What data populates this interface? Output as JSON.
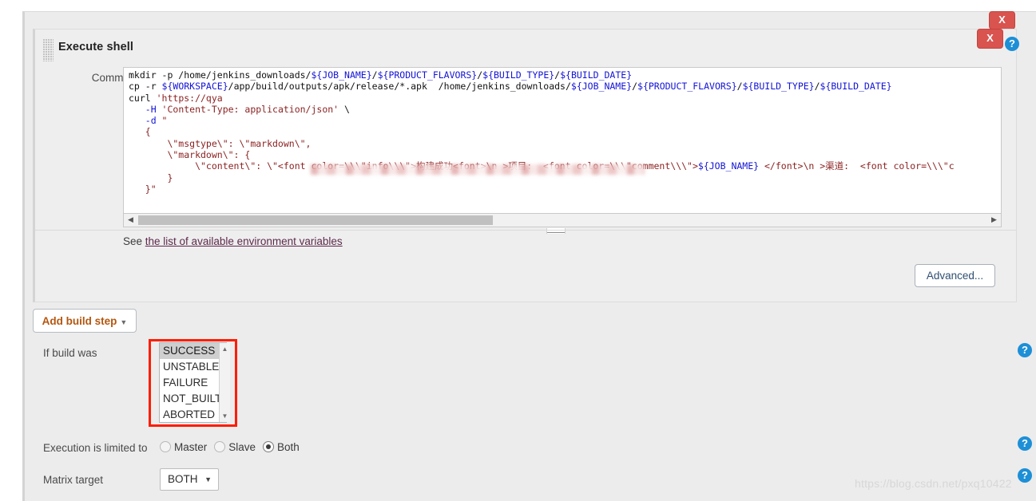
{
  "window": {
    "close_top_label": "X",
    "close_step_label": "X"
  },
  "build_step": {
    "title": "Execute shell",
    "grip_icon": "drag-grip-icon",
    "help_icon": "help-icon",
    "command": {
      "label": "Command",
      "lines": [
        [
          {
            "t": "mkdir -p /home/jenkins_downloads/",
            "c": "plain"
          },
          {
            "t": "${JOB_NAME}",
            "c": "var"
          },
          {
            "t": "/",
            "c": "plain"
          },
          {
            "t": "${PRODUCT_FLAVORS}",
            "c": "var"
          },
          {
            "t": "/",
            "c": "plain"
          },
          {
            "t": "${BUILD_TYPE}",
            "c": "var"
          },
          {
            "t": "/",
            "c": "plain"
          },
          {
            "t": "${BUILD_DATE}",
            "c": "var"
          }
        ],
        [
          {
            "t": "cp -r ",
            "c": "plain"
          },
          {
            "t": "${WORKSPACE}",
            "c": "var"
          },
          {
            "t": "/app/build/outputs/apk/release/*.apk  /home/jenkins_downloads/",
            "c": "plain"
          },
          {
            "t": "${JOB_NAME}",
            "c": "var"
          },
          {
            "t": "/",
            "c": "plain"
          },
          {
            "t": "${PRODUCT_FLAVORS}",
            "c": "var"
          },
          {
            "t": "/",
            "c": "plain"
          },
          {
            "t": "${BUILD_TYPE}",
            "c": "var"
          },
          {
            "t": "/",
            "c": "plain"
          },
          {
            "t": "${BUILD_DATE}",
            "c": "var"
          }
        ],
        [
          {
            "t": "curl ",
            "c": "plain"
          },
          {
            "t": "'https://qya",
            "c": "red"
          }
        ],
        [
          {
            "t": "   -H ",
            "c": "var"
          },
          {
            "t": "'Content-Type: application/json'",
            "c": "red"
          },
          {
            "t": " \\",
            "c": "plain"
          }
        ],
        [
          {
            "t": "   -d ",
            "c": "var"
          },
          {
            "t": "\"",
            "c": "red"
          }
        ],
        [
          {
            "t": "   {",
            "c": "red"
          }
        ],
        [
          {
            "t": "       \\\"msgtype\\\": \\\"markdown\\\",",
            "c": "red"
          }
        ],
        [
          {
            "t": "       \\\"markdown\\\": {",
            "c": "red"
          }
        ],
        [
          {
            "t": "            \\\"content\\\": \\\"<font color=\\\\\\\"info\\\\\\\">构建成功<font>\\n >项目:  <font color=\\\\\\\"comment\\\\\\\">",
            "c": "red"
          },
          {
            "t": "${JOB_NAME}",
            "c": "var"
          },
          {
            "t": " </font>\\n >渠道:  <font color=\\\\\\\"c",
            "c": "red"
          }
        ],
        [
          {
            "t": "       }",
            "c": "red"
          }
        ],
        [
          {
            "t": "   }\"",
            "c": "red"
          }
        ]
      ],
      "hscroll_left_arrow": "◀",
      "hscroll_right_arrow": "▶"
    },
    "env_hint_prefix": "See ",
    "env_hint_link": "the list of available environment variables",
    "advanced_label": "Advanced..."
  },
  "add_build_step": {
    "label": "Add build step",
    "caret": "▼"
  },
  "post_build": {
    "if_build_was_label": "If build was",
    "statuses": [
      "SUCCESS",
      "UNSTABLE",
      "FAILURE",
      "NOT_BUILT",
      "ABORTED"
    ],
    "selected_status": "SUCCESS",
    "scroll_up": "▲",
    "scroll_down": "▼",
    "highlight_color": "#fd1d00"
  },
  "execution": {
    "label": "Execution is limited to",
    "options": [
      {
        "label": "Master",
        "selected": false
      },
      {
        "label": "Slave",
        "selected": false
      },
      {
        "label": "Both",
        "selected": true
      }
    ]
  },
  "matrix": {
    "label": "Matrix target",
    "value": "BOTH",
    "caret": "▼"
  },
  "help_icons": {
    "glyph": "?"
  },
  "watermark": {
    "text": "https://blog.csdn.net/pxq10422"
  }
}
